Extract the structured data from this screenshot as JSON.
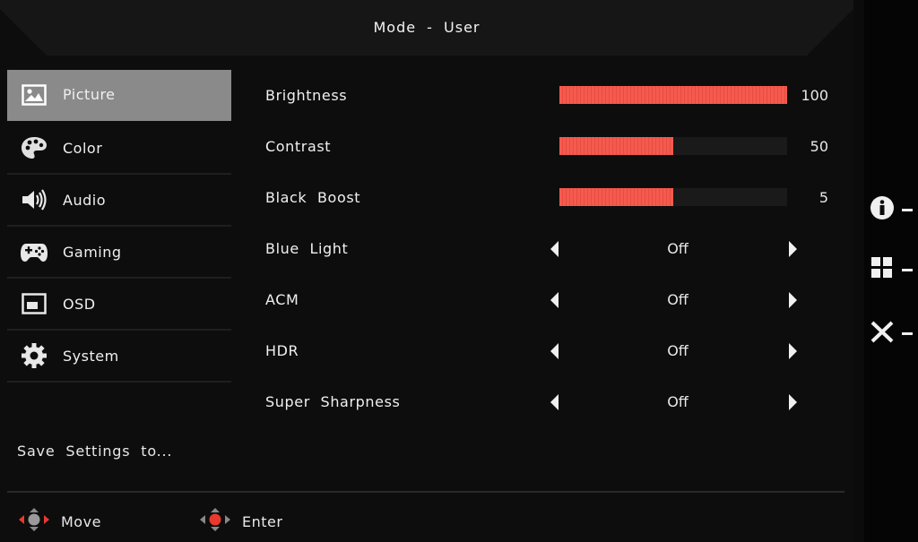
{
  "header": {
    "title": "Mode - User"
  },
  "sidebar": {
    "items": [
      {
        "label": "Picture",
        "icon": "picture-icon",
        "active": true
      },
      {
        "label": "Color",
        "icon": "palette-icon",
        "active": false
      },
      {
        "label": "Audio",
        "icon": "speaker-icon",
        "active": false
      },
      {
        "label": "Gaming",
        "icon": "gamepad-icon",
        "active": false
      },
      {
        "label": "OSD",
        "icon": "osd-window-icon",
        "active": false
      },
      {
        "label": "System",
        "icon": "gear-icon",
        "active": false
      }
    ],
    "save_settings": "Save Settings to..."
  },
  "picture_settings": {
    "brightness": {
      "label": "Brightness",
      "value": "100",
      "level": 1.0
    },
    "contrast": {
      "label": "Contrast",
      "value": "50",
      "level": 0.5
    },
    "black_boost": {
      "label": "Black Boost",
      "value": "5",
      "level": 0.5
    },
    "blue_light": {
      "label": "Blue Light",
      "value": "Off"
    },
    "acm": {
      "label": "ACM",
      "value": "Off"
    },
    "hdr": {
      "label": "HDR",
      "value": "Off"
    },
    "super_sharpness": {
      "label": "Super Sharpness",
      "value": "Off"
    }
  },
  "footer": {
    "move_label": "Move",
    "enter_label": "Enter"
  },
  "side_keys": [
    {
      "icon": "info-icon"
    },
    {
      "icon": "menu-grid-icon"
    },
    {
      "icon": "close-icon"
    }
  ],
  "colors": {
    "accent": "#f45a4e",
    "active_tab": "#8a8a8a",
    "joystick_center": "#e8392f"
  }
}
